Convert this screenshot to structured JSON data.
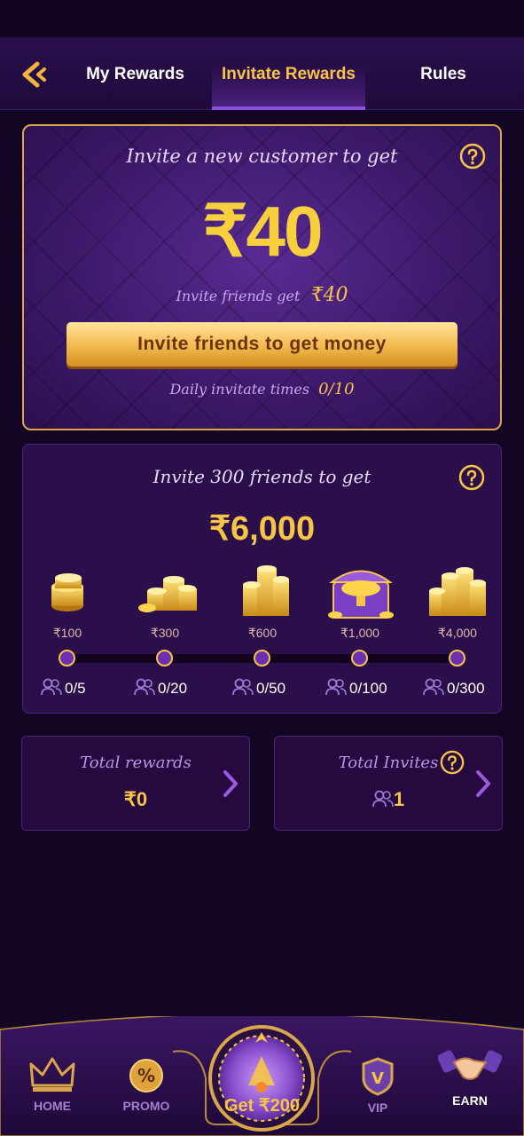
{
  "tabs": [
    {
      "label": "My Rewards"
    },
    {
      "label": "Invitate Rewards"
    },
    {
      "label": "Rules"
    }
  ],
  "invite_card": {
    "title": "Invite a new customer to get",
    "amount": "₹40",
    "friends_label": "Invite friends get",
    "friends_amount": "₹40",
    "button": "Invite friends to get money",
    "daily_label": "Daily invitate times",
    "daily_value": "0/10"
  },
  "milestone_card": {
    "title": "Invite 300 friends to get",
    "amount": "₹6,000",
    "tiers": [
      {
        "reward": "₹100",
        "count": "0/5"
      },
      {
        "reward": "₹300",
        "count": "0/20"
      },
      {
        "reward": "₹600",
        "count": "0/50"
      },
      {
        "reward": "₹1,000",
        "count": "0/100"
      },
      {
        "reward": "₹4,000",
        "count": "0/300"
      }
    ]
  },
  "totals": {
    "rewards_label": "Total rewards",
    "rewards_value": "₹0",
    "invites_label": "Total Invites",
    "invites_value": "1"
  },
  "nav": {
    "home": "HOME",
    "promo": "PROMO",
    "center": "Get ₹200",
    "vip": "VIP",
    "earn": "EARN"
  },
  "colors": {
    "gold": "#f6c546",
    "purple_bg": "#130524",
    "card_bg": "#2a0f4a",
    "accent_purple": "#8a4fe0"
  }
}
